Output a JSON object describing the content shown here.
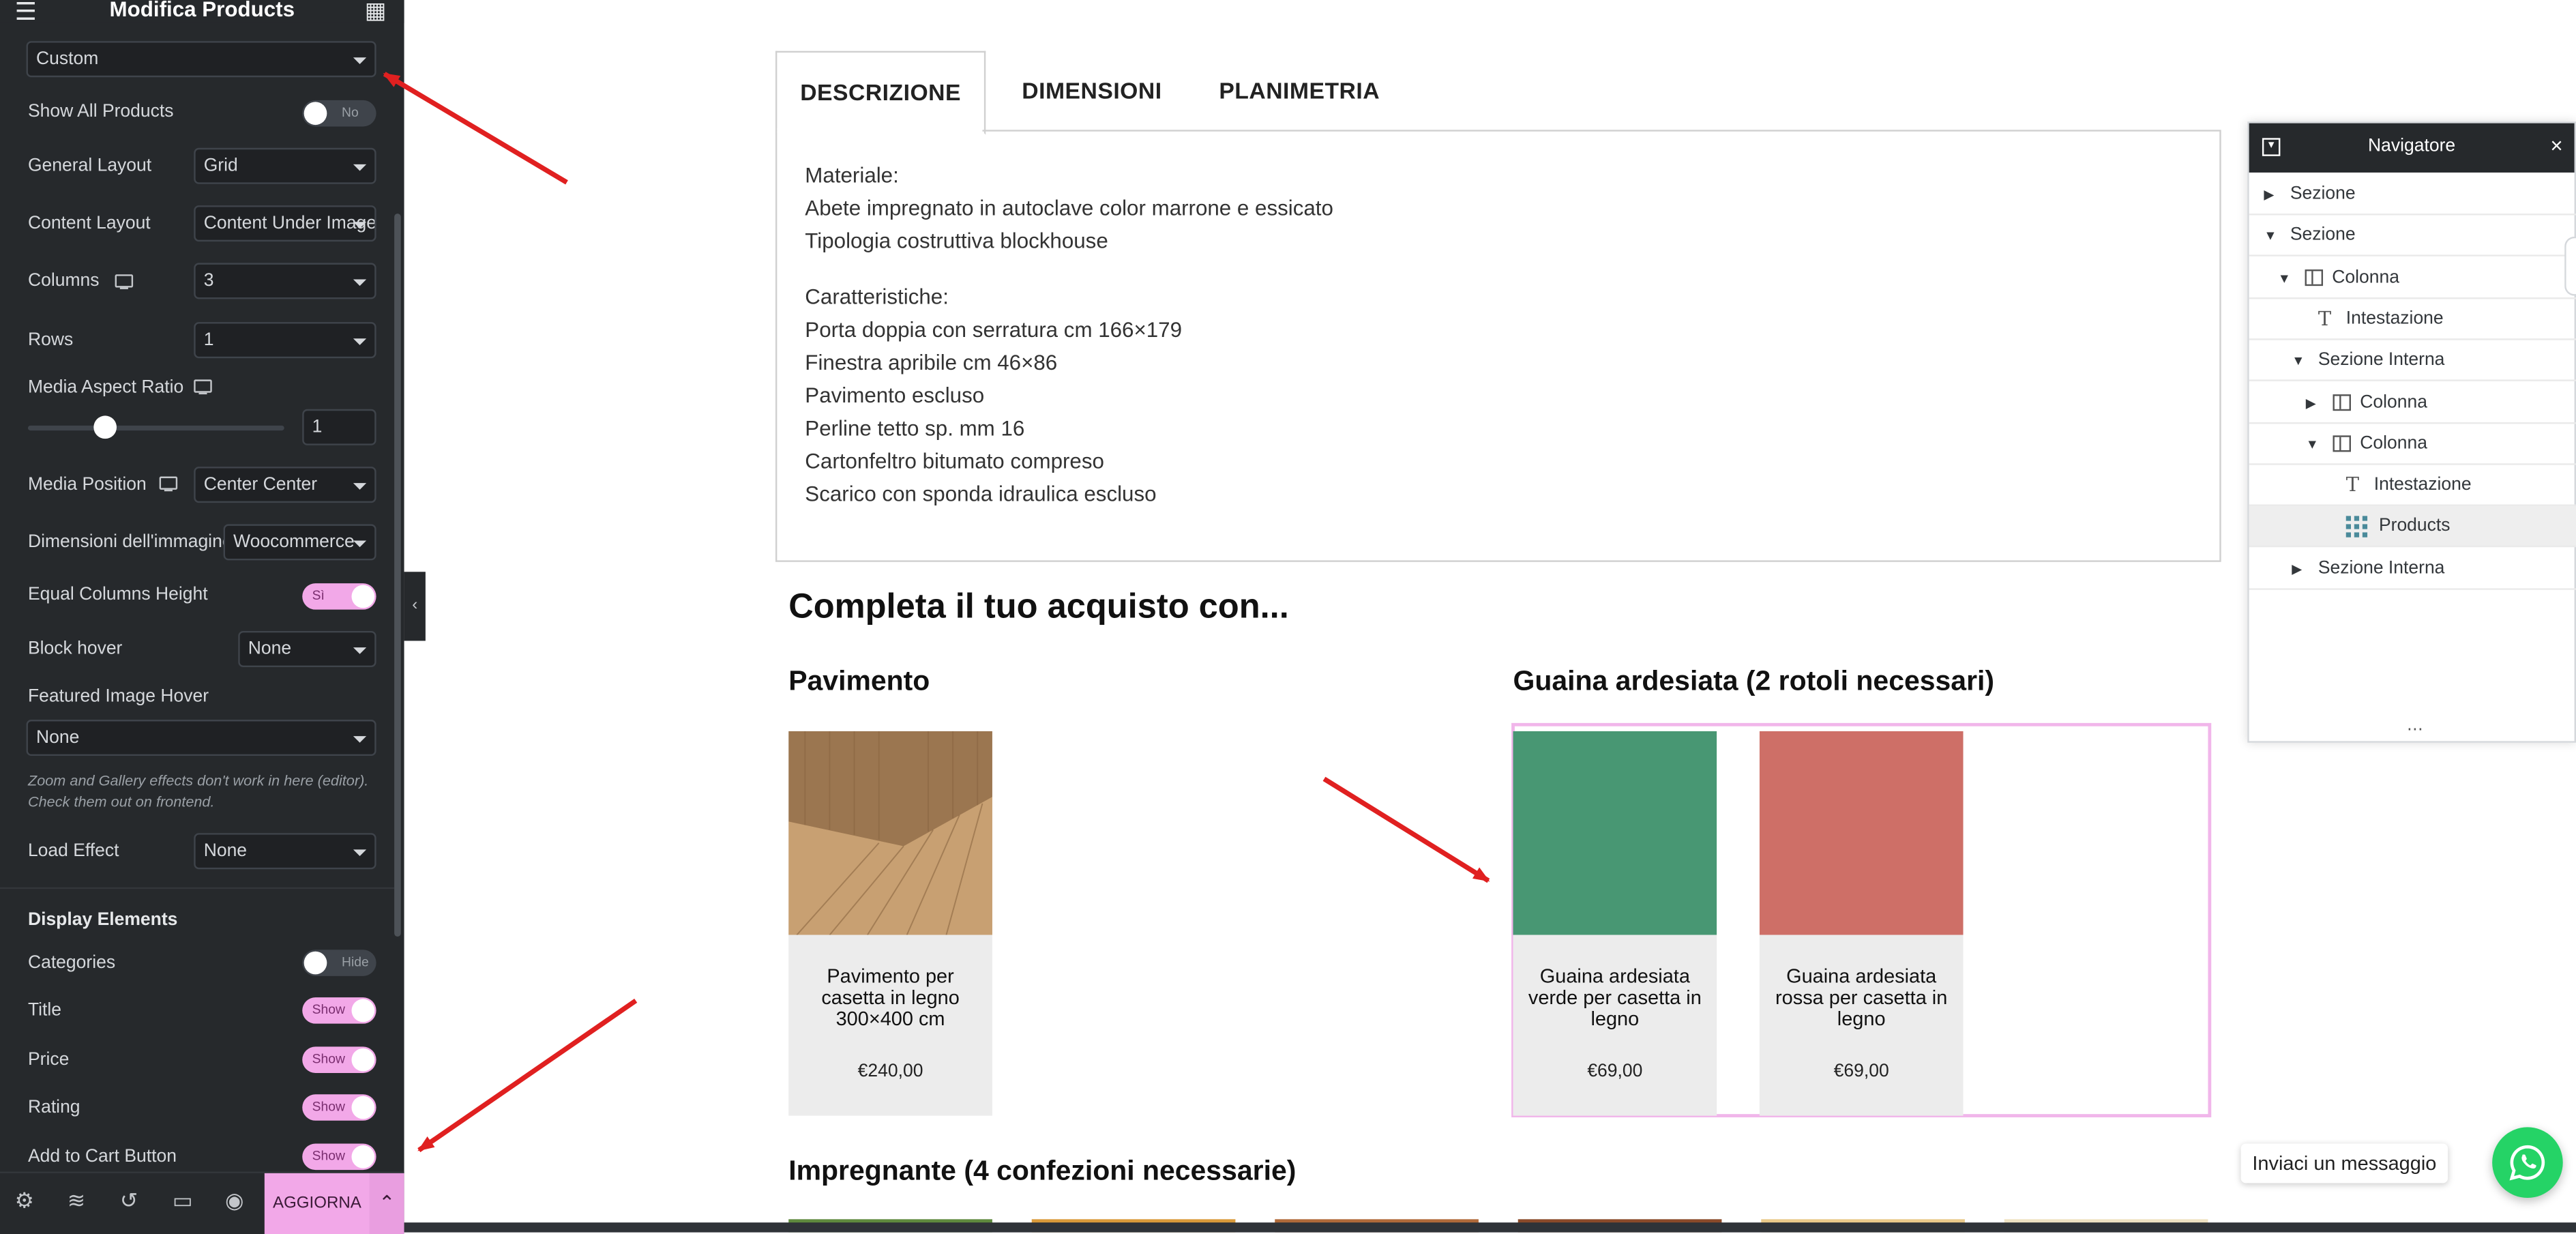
{
  "editor": {
    "title": "Modifica Products",
    "query_source": "Custom",
    "controls": {
      "show_all_products": {
        "label": "Show All Products",
        "value": "No"
      },
      "general_layout": {
        "label": "General Layout",
        "value": "Grid"
      },
      "content_layout": {
        "label": "Content Layout",
        "value": "Content Under Image"
      },
      "columns": {
        "label": "Columns",
        "value": "3"
      },
      "rows": {
        "label": "Rows",
        "value": "1"
      },
      "media_aspect_ratio": {
        "label": "Media Aspect Ratio",
        "value": "1",
        "slider_fraction": 0.3
      },
      "media_position": {
        "label": "Media Position",
        "value": "Center Center"
      },
      "image_size": {
        "label": "Dimensioni dell'immagine",
        "value": "Woocommerce"
      },
      "equal_columns_height": {
        "label": "Equal Columns Height",
        "value": "Sì"
      },
      "block_hover": {
        "label": "Block hover",
        "value": "None"
      },
      "featured_image_hover": {
        "label": "Featured Image Hover",
        "value": "None"
      },
      "note": "Zoom and Gallery effects don't work in here (editor). Check them out on frontend.",
      "load_effect": {
        "label": "Load Effect",
        "value": "None"
      }
    },
    "display_elements": {
      "title": "Display Elements",
      "categories": {
        "label": "Categories",
        "value": "Hide"
      },
      "title_el": {
        "label": "Title",
        "value": "Show"
      },
      "price": {
        "label": "Price",
        "value": "Show"
      },
      "rating": {
        "label": "Rating",
        "value": "Show"
      },
      "add_to_cart": {
        "label": "Add to Cart Button",
        "value": "Show"
      }
    },
    "footer": {
      "update_label": "AGGIORNA"
    }
  },
  "page": {
    "tabs": [
      "DESCRIZIONE",
      "DIMENSIONI",
      "PLANIMETRIA"
    ],
    "description": {
      "materiale_heading": "Materiale:",
      "materiale_lines": [
        "Abete impregnato in autoclave color marrone e essicato",
        "Tipologia costruttiva blockhouse"
      ],
      "caratteristiche_heading": "Caratteristiche:",
      "caratteristiche_lines": [
        "Porta doppia con serratura cm 166×179",
        "Finestra apribile cm 46×86",
        "Pavimento escluso",
        "Perline tetto sp. mm 16",
        "Cartonfeltro bitumato compreso",
        "Scarico con sponda idraulica escluso"
      ]
    },
    "upsell_heading": "Completa il tuo acquisto con...",
    "pavimento": {
      "heading": "Pavimento",
      "products": [
        {
          "title": "Pavimento per casetta in legno 300×400 cm",
          "price": "€240,00"
        }
      ]
    },
    "guaina": {
      "heading": "Guaina ardesiata (2 rotoli necessari)",
      "products": [
        {
          "title": "Guaina ardesiata verde per casetta in legno",
          "price": "€69,00",
          "color": "#4f9e7a"
        },
        {
          "title": "Guaina ardesiata rossa per casetta in legno",
          "price": "€69,00",
          "color": "#d4776f"
        }
      ]
    },
    "impregnante_heading": "Impregnante (4 confezioni necessarie)"
  },
  "navigator": {
    "title": "Navigatore",
    "items": [
      {
        "label": "Sezione",
        "depth": 0,
        "expander": "collapsed",
        "icon": "none"
      },
      {
        "label": "Sezione",
        "depth": 0,
        "expander": "expanded",
        "icon": "none"
      },
      {
        "label": "Colonna",
        "depth": 1,
        "expander": "expanded",
        "icon": "column-icon"
      },
      {
        "label": "Intestazione",
        "depth": 2,
        "expander": "none",
        "icon": "heading-icon"
      },
      {
        "label": "Sezione Interna",
        "depth": 2,
        "expander": "expanded",
        "icon": "none"
      },
      {
        "label": "Colonna",
        "depth": 3,
        "expander": "collapsed",
        "icon": "column-icon"
      },
      {
        "label": "Colonna",
        "depth": 3,
        "expander": "expanded",
        "icon": "column-icon"
      },
      {
        "label": "Intestazione",
        "depth": 4,
        "expander": "none",
        "icon": "heading-icon"
      },
      {
        "label": "Products",
        "depth": 4,
        "expander": "none",
        "icon": "products-grid-icon",
        "selected": true
      },
      {
        "label": "Sezione Interna",
        "depth": 2,
        "expander": "collapsed",
        "icon": "none"
      }
    ]
  },
  "whatsapp": {
    "label": "Inviaci un messaggio"
  },
  "colors": {
    "accent": "#f2a8e8",
    "panel_bg": "#26292c",
    "arrow": "#e02020"
  }
}
